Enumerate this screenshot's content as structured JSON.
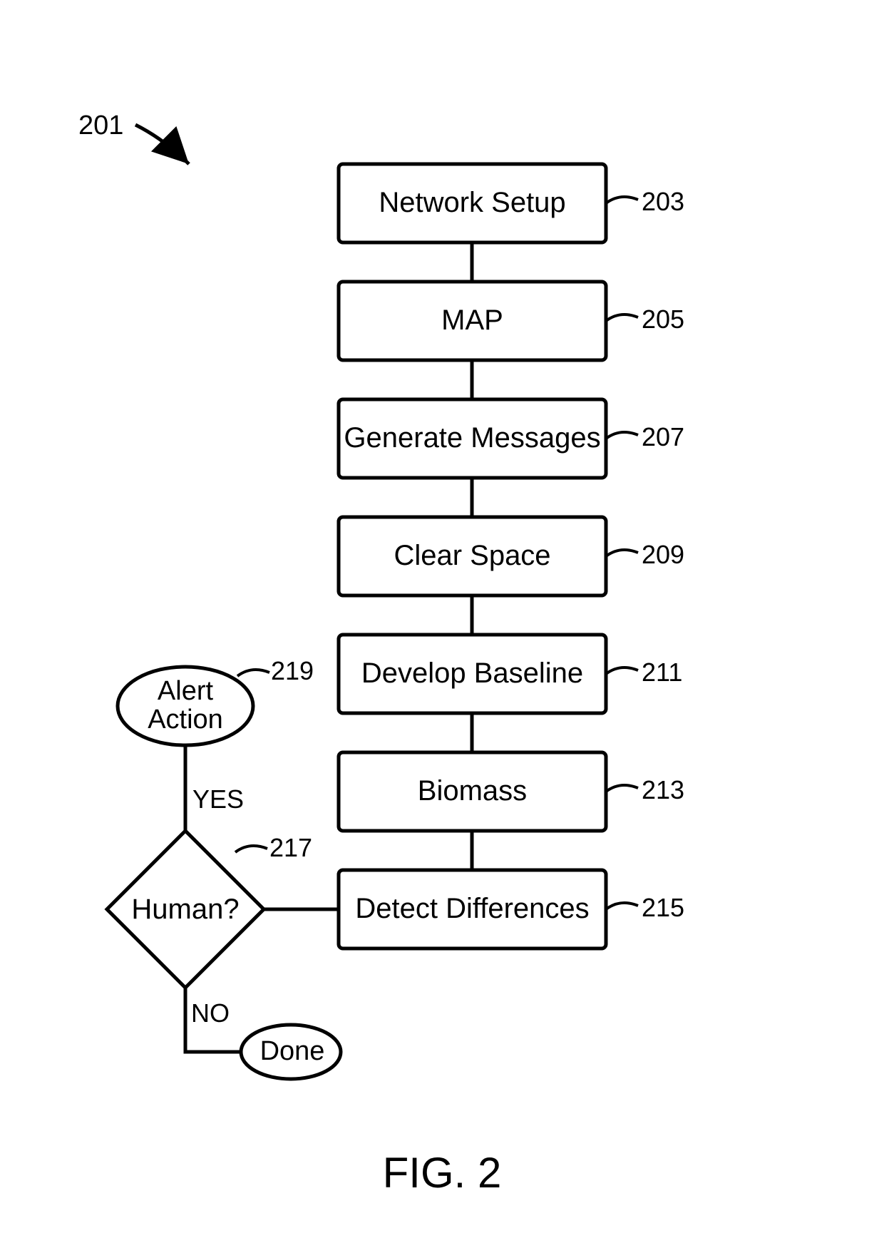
{
  "chart_data": {
    "type": "flowchart",
    "figure_number": "201",
    "figure_caption": "FIG. 2",
    "nodes": [
      {
        "id": "203",
        "ref": "203",
        "shape": "rect",
        "label": "Network Setup"
      },
      {
        "id": "205",
        "ref": "205",
        "shape": "rect",
        "label": "MAP"
      },
      {
        "id": "207",
        "ref": "207",
        "shape": "rect",
        "label": "Generate Messages"
      },
      {
        "id": "209",
        "ref": "209",
        "shape": "rect",
        "label": "Clear Space"
      },
      {
        "id": "211",
        "ref": "211",
        "shape": "rect",
        "label": "Develop Baseline"
      },
      {
        "id": "213",
        "ref": "213",
        "shape": "rect",
        "label": "Biomass"
      },
      {
        "id": "215",
        "ref": "215",
        "shape": "rect",
        "label": "Detect Differences"
      },
      {
        "id": "217",
        "ref": "217",
        "shape": "diamond",
        "label": "Human?"
      },
      {
        "id": "219",
        "ref": "219",
        "shape": "ellipse",
        "label": "Alert\nAction"
      },
      {
        "id": "done",
        "ref": "",
        "shape": "ellipse",
        "label": "Done"
      }
    ],
    "edges": [
      {
        "from": "203",
        "to": "205",
        "label": ""
      },
      {
        "from": "205",
        "to": "207",
        "label": ""
      },
      {
        "from": "207",
        "to": "209",
        "label": ""
      },
      {
        "from": "209",
        "to": "211",
        "label": ""
      },
      {
        "from": "211",
        "to": "213",
        "label": ""
      },
      {
        "from": "213",
        "to": "215",
        "label": ""
      },
      {
        "from": "215",
        "to": "217",
        "label": ""
      },
      {
        "from": "217",
        "to": "219",
        "label": "YES"
      },
      {
        "from": "217",
        "to": "done",
        "label": "NO"
      }
    ]
  }
}
